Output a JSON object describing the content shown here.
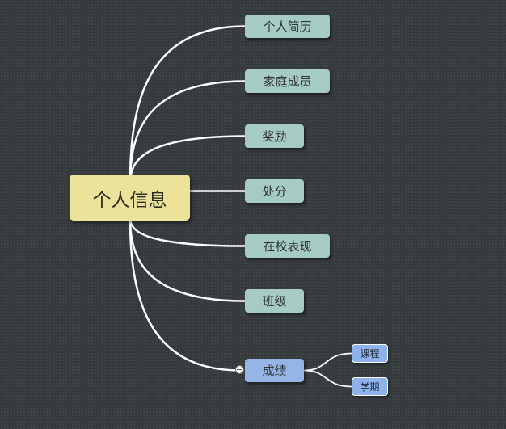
{
  "colors": {
    "background": "#353a3d",
    "line": "#ffffff",
    "root_fill": "#ede29a",
    "branch_fill": "#a5cbc3",
    "branch_fill_active": "#96b4e6",
    "leaf_fill": "#8fb2ea",
    "leaf_border": "#ffffff"
  },
  "mindmap": {
    "root": {
      "label": "个人信息"
    },
    "branches": [
      {
        "label": "个人简历"
      },
      {
        "label": "家庭成员"
      },
      {
        "label": "奖励"
      },
      {
        "label": "处分"
      },
      {
        "label": "在校表现"
      },
      {
        "label": "班级"
      },
      {
        "label": "成绩",
        "collapsed": false,
        "children": [
          {
            "label": "课程"
          },
          {
            "label": "学期"
          }
        ]
      }
    ]
  }
}
